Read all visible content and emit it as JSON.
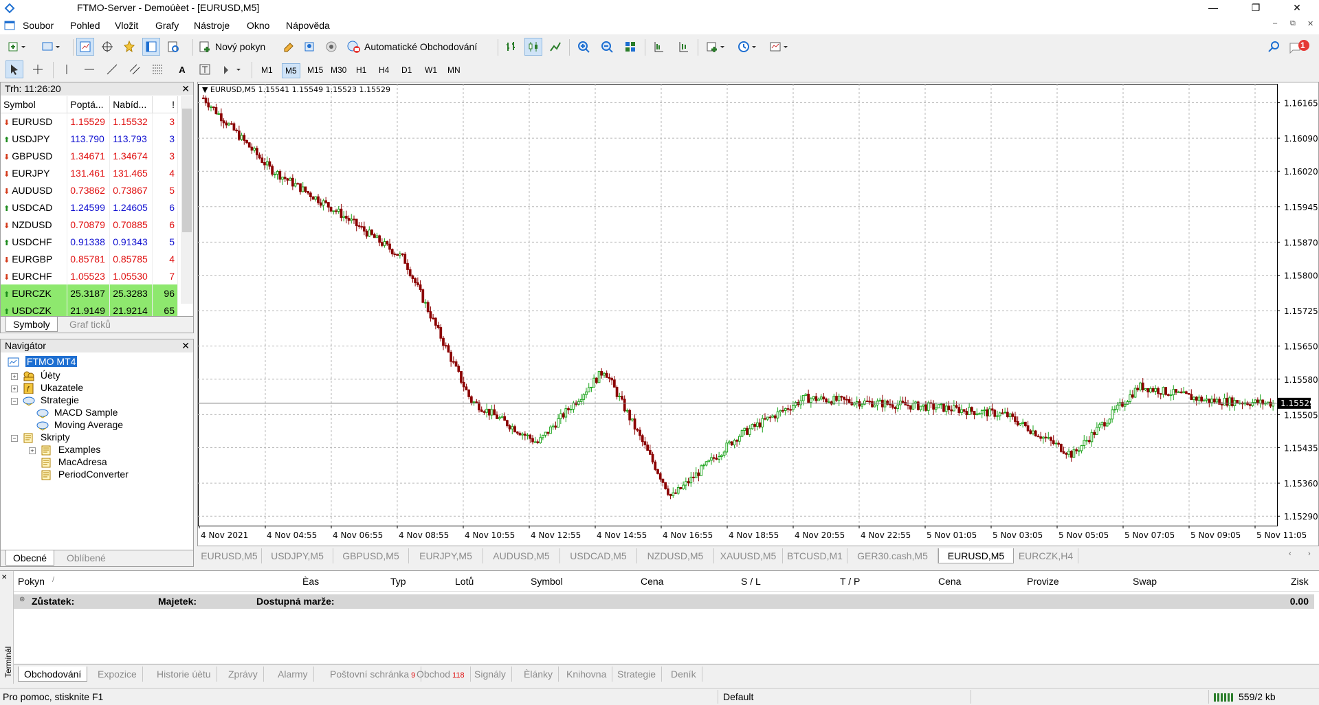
{
  "window": {
    "title": "FTMO-Server - Demoúèet - [EURUSD,M5]",
    "minimize": "—",
    "maximize": "❐",
    "close": "✕"
  },
  "menu": [
    "Soubor",
    "Pohled",
    "Vložit",
    "Grafy",
    "Nástroje",
    "Okno",
    "Nápověda"
  ],
  "mdi_controls": [
    "–",
    "⧉",
    "✕"
  ],
  "toolbar": {
    "new_order": "Nový pokyn",
    "auto_trading": "Automatické Obchodování",
    "notification_count": "1"
  },
  "timeframes": [
    "M1",
    "M5",
    "M15",
    "M30",
    "H1",
    "H4",
    "D1",
    "W1",
    "MN"
  ],
  "active_timeframe": "M5",
  "market_watch": {
    "title": "Trh: 11:26:20",
    "headers": [
      "Symbol",
      "Poptá...",
      "Nabíd...",
      "!"
    ],
    "rows": [
      {
        "symbol": "EURUSD",
        "bid": "1.15529",
        "ask": "1.15532",
        "spread": "3",
        "dir": "down"
      },
      {
        "symbol": "USDJPY",
        "bid": "113.790",
        "ask": "113.793",
        "spread": "3",
        "dir": "up"
      },
      {
        "symbol": "GBPUSD",
        "bid": "1.34671",
        "ask": "1.34674",
        "spread": "3",
        "dir": "down"
      },
      {
        "symbol": "EURJPY",
        "bid": "131.461",
        "ask": "131.465",
        "spread": "4",
        "dir": "down"
      },
      {
        "symbol": "AUDUSD",
        "bid": "0.73862",
        "ask": "0.73867",
        "spread": "5",
        "dir": "down"
      },
      {
        "symbol": "USDCAD",
        "bid": "1.24599",
        "ask": "1.24605",
        "spread": "6",
        "dir": "up"
      },
      {
        "symbol": "NZDUSD",
        "bid": "0.70879",
        "ask": "0.70885",
        "spread": "6",
        "dir": "down"
      },
      {
        "symbol": "USDCHF",
        "bid": "0.91338",
        "ask": "0.91343",
        "spread": "5",
        "dir": "up"
      },
      {
        "symbol": "EURGBP",
        "bid": "0.85781",
        "ask": "0.85785",
        "spread": "4",
        "dir": "down"
      },
      {
        "symbol": "EURCHF",
        "bid": "1.05523",
        "ask": "1.05530",
        "spread": "7",
        "dir": "down"
      },
      {
        "symbol": "EURCZK",
        "bid": "25.3187",
        "ask": "25.3283",
        "spread": "96",
        "dir": "up",
        "highlight": true
      },
      {
        "symbol": "USDCZK",
        "bid": "21.9149",
        "ask": "21.9214",
        "spread": "65",
        "dir": "up",
        "highlight": true
      }
    ],
    "tabs": [
      "Symboly",
      "Graf ticků"
    ]
  },
  "navigator": {
    "title": "Navigátor",
    "root": "FTMO MT4",
    "items": {
      "accounts": "Úèty",
      "indicators": "Ukazatele",
      "strategies": "Strategie",
      "macd": "MACD Sample",
      "moving_average": "Moving Average",
      "scripts": "Skripty",
      "examples": "Examples",
      "macadresa": "MacAdresa",
      "period_converter": "PeriodConverter"
    },
    "tabs": [
      "Obecné",
      "Oblíbené"
    ]
  },
  "chart": {
    "label": "EURUSD,M5  1.15541 1.15549 1.15523 1.15529",
    "current_price": "1.15529",
    "price_ticks": [
      "1.16165",
      "1.16090",
      "1.16020",
      "1.15945",
      "1.15870",
      "1.15800",
      "1.15725",
      "1.15650",
      "1.15580",
      "1.15505",
      "1.15435",
      "1.15360",
      "1.15290"
    ],
    "time_ticks": [
      "4 Nov 2021",
      "4 Nov 04:55",
      "4 Nov 06:55",
      "4 Nov 08:55",
      "4 Nov 10:55",
      "4 Nov 12:55",
      "4 Nov 14:55",
      "4 Nov 16:55",
      "4 Nov 18:55",
      "4 Nov 20:55",
      "4 Nov 22:55",
      "5 Nov 01:05",
      "5 Nov 03:05",
      "5 Nov 05:05",
      "5 Nov 07:05",
      "5 Nov 09:05",
      "5 Nov 11:05"
    ],
    "colors": {
      "up": "#1fa51f",
      "down": "#8b0000",
      "grid": "#b8b8b8",
      "price_line": "#808080"
    }
  },
  "chart_data": {
    "type": "line",
    "symbol": "EURUSD,M5",
    "x": [
      "4 Nov 2021",
      "4 Nov 04:55",
      "4 Nov 06:55",
      "4 Nov 08:55",
      "4 Nov 10:55",
      "4 Nov 12:55",
      "4 Nov 14:55",
      "4 Nov 16:55",
      "4 Nov 18:55",
      "4 Nov 20:55",
      "4 Nov 22:55",
      "5 Nov 01:05",
      "5 Nov 03:05",
      "5 Nov 05:05",
      "5 Nov 07:05",
      "5 Nov 09:05",
      "5 Nov 11:05"
    ],
    "series": [
      {
        "values": [
          1.16175,
          1.16025,
          1.15935,
          1.15835,
          1.15535,
          1.15445,
          1.156,
          1.1533,
          1.1546,
          1.1554,
          1.1553,
          1.1552,
          1.15505,
          1.1542,
          1.15565,
          1.15535,
          1.15529
        ]
      }
    ],
    "ylim": [
      1.1527,
      1.16205
    ],
    "grid": true
  },
  "chart_tabs": [
    "EURUSD,M5",
    "USDJPY,M5",
    "GBPUSD,M5",
    "EURJPY,M5",
    "AUDUSD,M5",
    "USDCAD,M5",
    "NZDUSD,M5",
    "XAUUSD,M5",
    "BTCUSD,M1",
    "GER30.cash,M5",
    "EURUSD,M5",
    "EURCZK,H4"
  ],
  "active_chart_tab": 10,
  "terminal": {
    "side_label": "Terminál",
    "columns": [
      "Pokyn",
      "Èas",
      "Typ",
      "Lotů",
      "Symbol",
      "Cena",
      "S / L",
      "T / P",
      "Cena",
      "Provize",
      "Swap",
      "Zisk"
    ],
    "balance_label": "Zůstatek:",
    "equity_label": "Majetek:",
    "free_margin_label": "Dostupná marže:",
    "total": "0.00",
    "tabs": [
      {
        "label": "Obchodování"
      },
      {
        "label": "Expozice"
      },
      {
        "label": "Historie úètu"
      },
      {
        "label": "Zprávy"
      },
      {
        "label": "Alarmy"
      },
      {
        "label": "Poštovní schránka",
        "count": "9"
      },
      {
        "label": "Obchod",
        "count": "118"
      },
      {
        "label": "Signály"
      },
      {
        "label": "Èlánky"
      },
      {
        "label": "Knihovna"
      },
      {
        "label": "Strategie"
      },
      {
        "label": "Deník"
      }
    ]
  },
  "statusbar": {
    "help": "Pro pomoc, stisknite F1",
    "profile": "Default",
    "traffic": "559/2 kb"
  }
}
